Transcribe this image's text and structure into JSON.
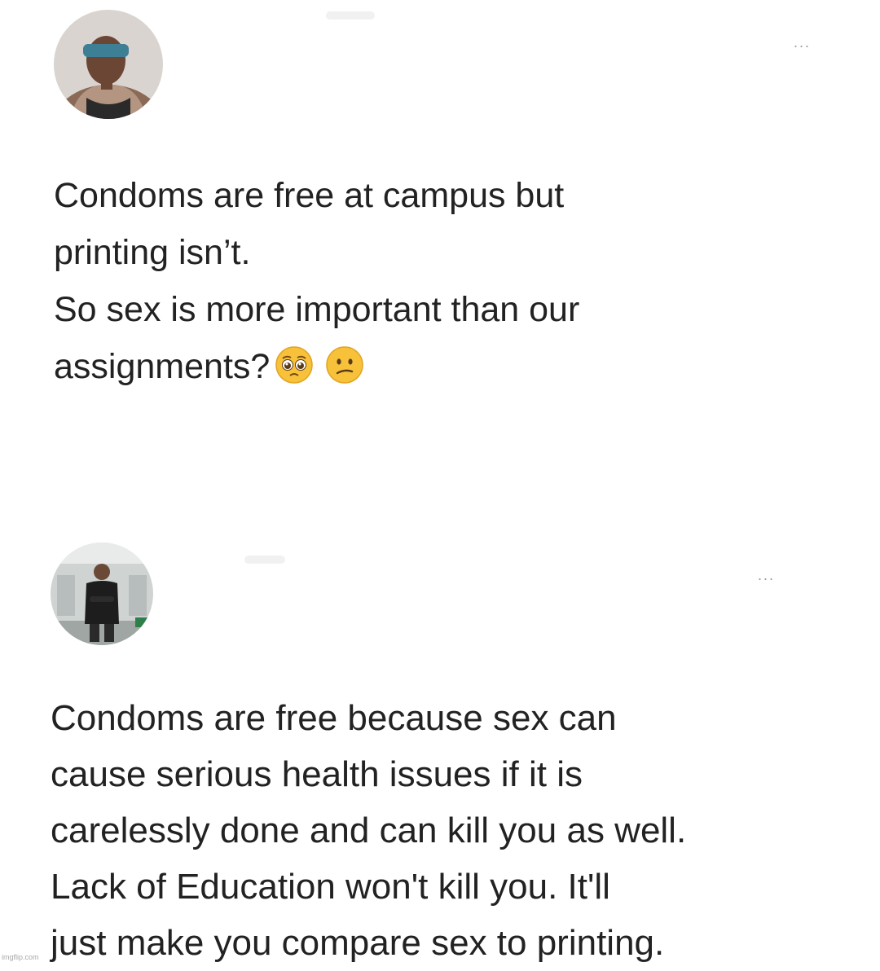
{
  "post_1": {
    "menu_label": "...",
    "text_lines": [
      "Condoms are free at campus but",
      "printing isn’t.",
      "So sex is more important than our",
      "assignments?"
    ],
    "emojis": [
      "pleading-face",
      "confused-face"
    ]
  },
  "post_2": {
    "menu_label": "...",
    "text_lines": [
      "Condoms are free because sex can",
      "cause serious health issues if it is",
      "carelessly done and can kill you as well.",
      "Lack of Education won't kill you. It'll",
      "just make you compare sex to printing."
    ]
  },
  "watermark": "imgflip.com",
  "colors": {
    "background": "#ffffff",
    "text": "#222222",
    "menu": "#9a9a9a"
  }
}
